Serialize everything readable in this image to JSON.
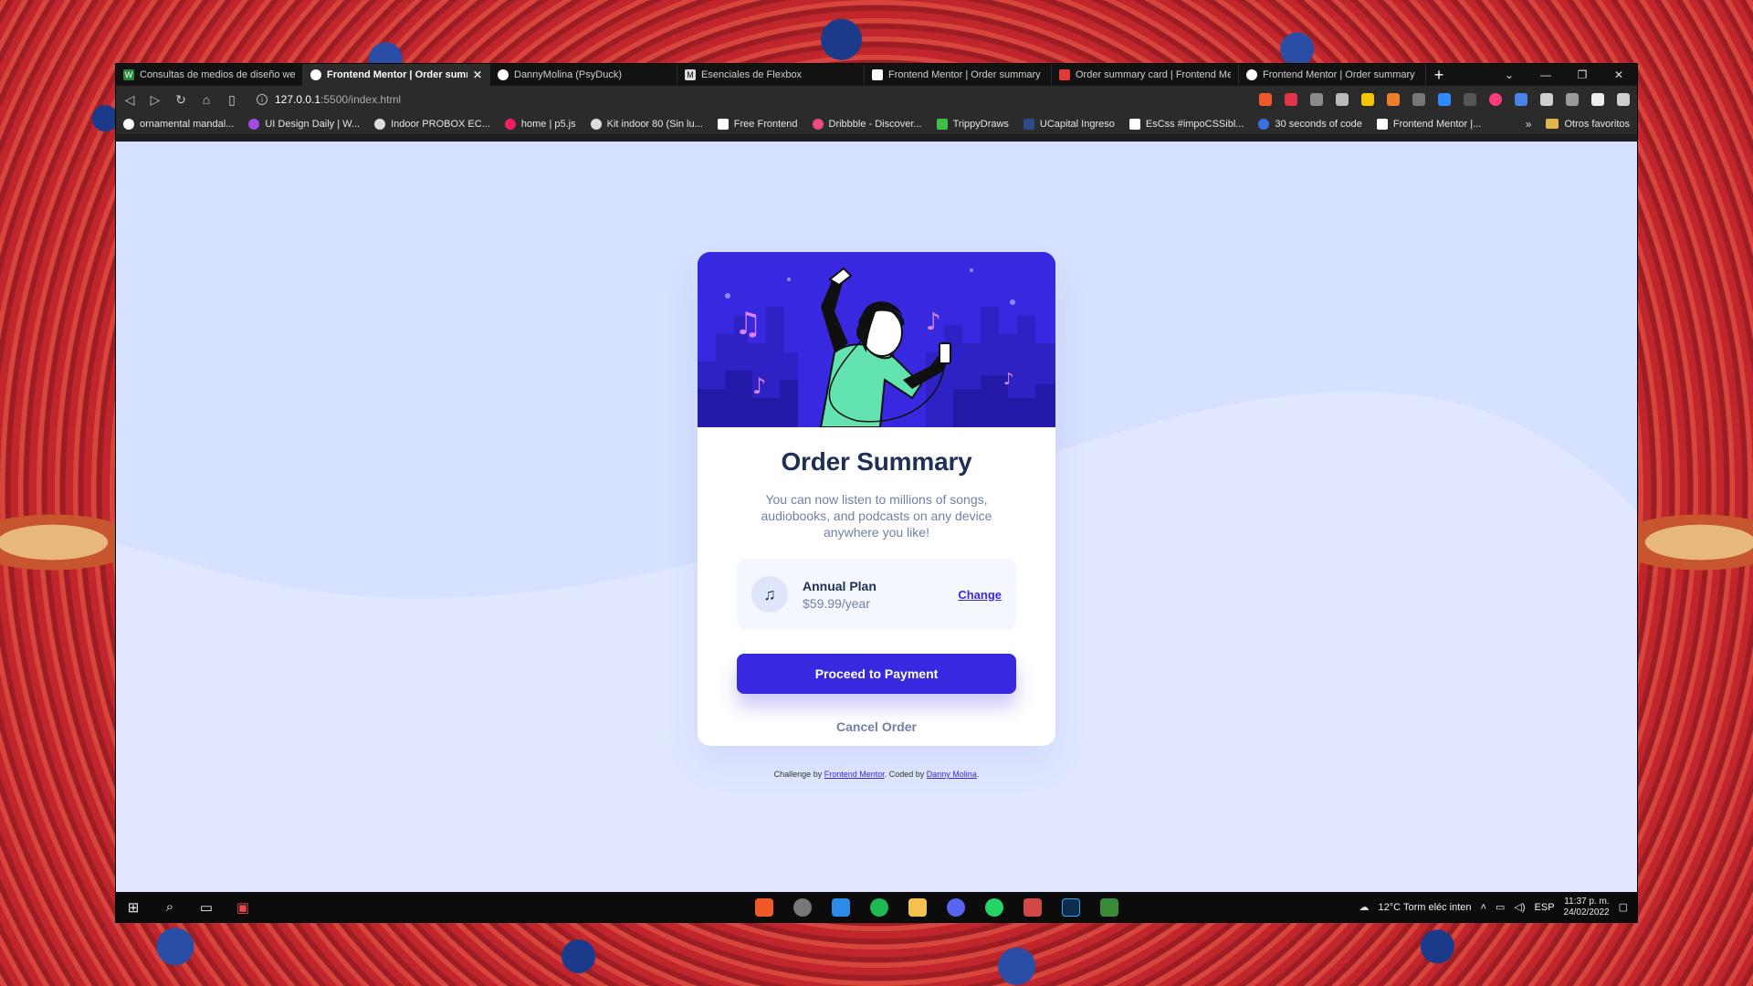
{
  "tabs": [
    {
      "title": "Consultas de medios de diseño web r",
      "active": false
    },
    {
      "title": "Frontend Mentor | Order summa",
      "active": true
    },
    {
      "title": "DannyMolina (PsyDuck)",
      "active": false
    },
    {
      "title": "Esenciales de Flexbox",
      "active": false
    },
    {
      "title": "Frontend Mentor | Order summary ca",
      "active": false
    },
    {
      "title": "Order summary card | Frontend Men",
      "active": false
    },
    {
      "title": "Frontend Mentor | Order summary ca",
      "active": false
    }
  ],
  "address": {
    "host": "127.0.0.1",
    "path": ":5500/index.html"
  },
  "bookmarks": [
    "ornamental mandal...",
    "UI Design Daily | W...",
    "Indoor PROBOX EC...",
    "home | p5.js",
    "Kit indoor 80 (Sin lu...",
    "Free Frontend",
    "Dribbble - Discover...",
    "TrippyDraws",
    "UCapital Ingreso",
    "EsCss #impoCSSibl...",
    "30 seconds of code",
    "Frontend Mentor |..."
  ],
  "bookmarks_more": "»",
  "other_bookmarks": "Otros favoritos",
  "card": {
    "title": "Order Summary",
    "description": "You can now listen to millions of songs, audiobooks, and podcasts on any device anywhere you like!",
    "plan_name": "Annual Plan",
    "plan_price": "$59.99/year",
    "change_label": "Change",
    "pay_label": "Proceed to Payment",
    "cancel_label": "Cancel Order"
  },
  "attribution": {
    "prefix": "Challenge by ",
    "fm": "Frontend Mentor",
    "mid": ". Coded by ",
    "author": "Danny Molina",
    "suffix": "."
  },
  "taskbar": {
    "weather": "12°C  Torm eléc inten",
    "lang": "ESP",
    "time": "11:37 p. m.",
    "date": "24/02/2022"
  },
  "colors": {
    "accent": "#3829e0",
    "page_bg": "#e0e8ff",
    "title": "#1f2f56",
    "muted": "#7280a7"
  }
}
